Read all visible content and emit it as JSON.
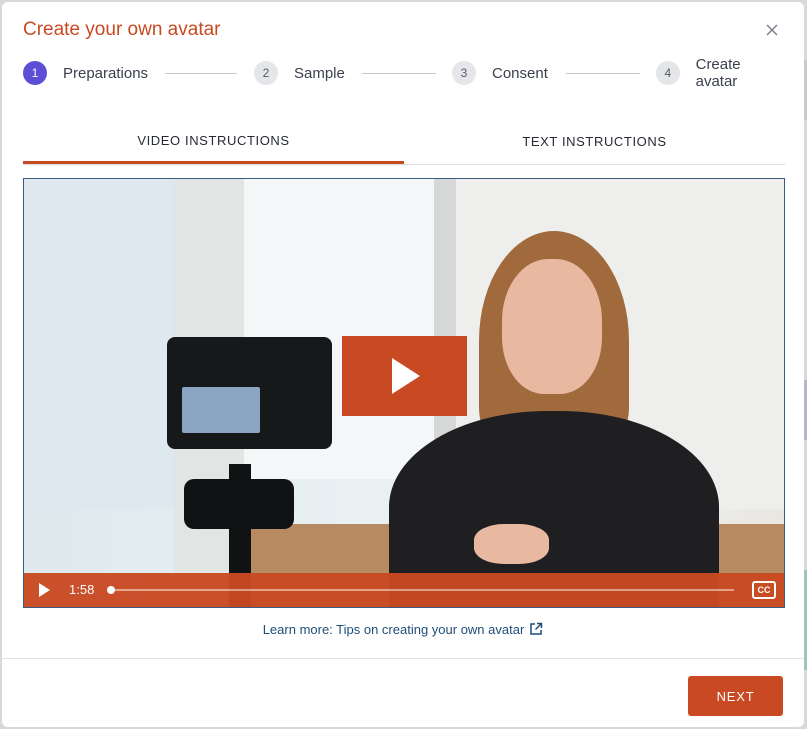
{
  "modal": {
    "title": "Create your own avatar"
  },
  "stepper": {
    "steps": [
      {
        "number": "1",
        "label": "Preparations",
        "active": true
      },
      {
        "number": "2",
        "label": "Sample",
        "active": false
      },
      {
        "number": "3",
        "label": "Consent",
        "active": false
      },
      {
        "number": "4",
        "label": "Create avatar",
        "active": false
      }
    ]
  },
  "tabs": [
    {
      "label": "VIDEO INSTRUCTIONS",
      "active": true
    },
    {
      "label": "TEXT INSTRUCTIONS",
      "active": false
    }
  ],
  "video": {
    "duration": "1:58",
    "cc_label": "CC",
    "progress": 0
  },
  "learn_more": {
    "text": "Learn more: Tips on creating your own avatar"
  },
  "footer": {
    "next_label": "NEXT"
  },
  "colors": {
    "accent": "#c94a22",
    "active_step": "#5b4fd6",
    "link": "#1f4e79"
  },
  "icons": [
    "close-icon",
    "play-icon",
    "closed-captions-icon",
    "external-link-icon"
  ]
}
